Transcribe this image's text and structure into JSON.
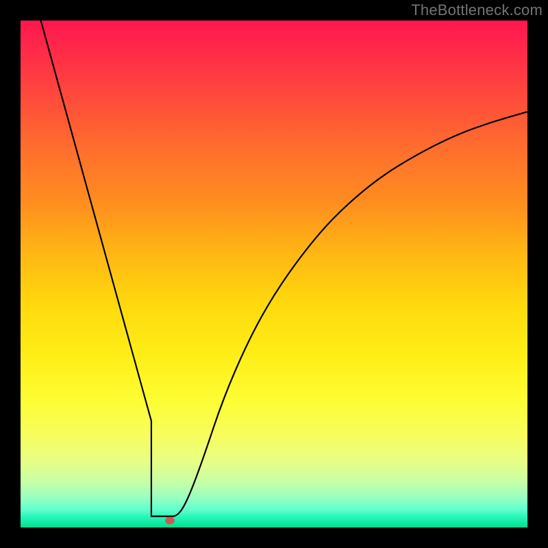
{
  "watermark": "TheBottleneck.com",
  "chart_data": {
    "type": "line",
    "title": "",
    "xlabel": "",
    "ylabel": "",
    "xlim": [
      0,
      1
    ],
    "ylim": [
      0,
      1
    ],
    "series": [
      {
        "name": "curve",
        "x": [
          0.04,
          0.08,
          0.12,
          0.16,
          0.2,
          0.24,
          0.258,
          0.275,
          0.29,
          0.31,
          0.33,
          0.36,
          0.4,
          0.45,
          0.5,
          0.56,
          0.62,
          0.7,
          0.78,
          0.86,
          0.93,
          1.0
        ],
        "y": [
          1.0,
          0.855,
          0.71,
          0.565,
          0.42,
          0.275,
          0.21,
          0.1,
          0.022,
          0.022,
          0.055,
          0.135,
          0.255,
          0.37,
          0.46,
          0.545,
          0.615,
          0.685,
          0.735,
          0.775,
          0.8,
          0.82
        ]
      }
    ],
    "flat_segment": {
      "x": [
        0.258,
        0.29
      ],
      "y": 0.022
    },
    "marker": {
      "x": 0.295,
      "y": 0.013,
      "color": "#c95c52"
    },
    "gradient_stops": [
      {
        "pos": 0.0,
        "color": "#ff1650"
      },
      {
        "pos": 0.5,
        "color": "#ffd000"
      },
      {
        "pos": 0.78,
        "color": "#fdfd40"
      },
      {
        "pos": 1.0,
        "color": "#00e08e"
      }
    ]
  }
}
